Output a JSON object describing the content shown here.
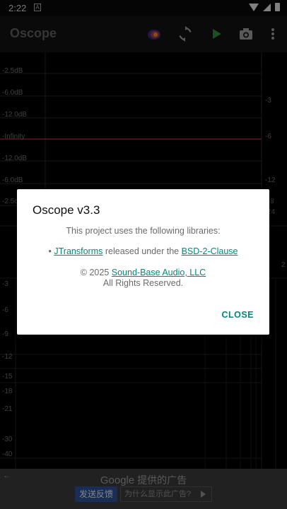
{
  "status_bar": {
    "time": "2:22",
    "notification_letter": "A"
  },
  "app_bar": {
    "title": "Oscope",
    "actions": [
      "spectrum-icon",
      "refresh-icon",
      "play-icon",
      "camera-icon",
      "more-icon"
    ]
  },
  "scope": {
    "upper_left_labels": [
      "-2.5dB",
      "-6.0dB",
      "-12.0dB",
      "-Infinity",
      "-12.0dB",
      "-6.0dB",
      "-2.5d"
    ],
    "upper_right_labels": [
      "-3",
      "-6",
      "-12",
      "8",
      "24"
    ],
    "lower_left_labels": [
      "-3",
      "-6",
      "-9",
      "-12",
      "-15",
      "-18",
      "-21",
      "-30",
      "-40"
    ],
    "right_edge_label": "2",
    "trace_color": "#b83a3a"
  },
  "ad": {
    "brand": "Google",
    "tagline": "提供的广告",
    "feedback_label": "发送反馈",
    "why_label": "为什么显示此广告?"
  },
  "dialog": {
    "title": "Oscope v3.3",
    "intro": "This project uses the following libraries:",
    "library_name": "JTransforms",
    "released_text": "released under the",
    "license_name": "BSD-2-Clause",
    "copyright_prefix": "© 2025",
    "company_name": "Sound-Base Audio, LLC",
    "rights": "All Rights Reserved.",
    "close_label": "CLOSE"
  },
  "colors": {
    "accent": "#00897b",
    "trace": "#b83a3a"
  }
}
